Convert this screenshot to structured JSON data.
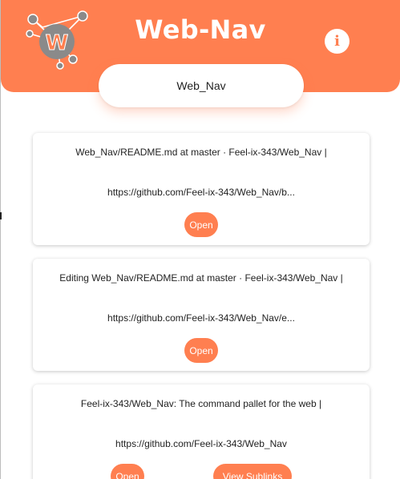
{
  "app": {
    "title": "Web-Nav",
    "info_icon": "info-icon",
    "logo_letter": "W"
  },
  "search": {
    "value": "Web_Nav"
  },
  "results": [
    {
      "title": "Web_Nav/README.md at master · Feel-ix-343/Web_Nav |",
      "url": "https://github.com/Feel-ix-343/Web_Nav/b...",
      "open_label": "Open"
    },
    {
      "title": "Editing Web_Nav/README.md at master · Feel-ix-343/Web_Nav |",
      "url": "https://github.com/Feel-ix-343/Web_Nav/e...",
      "open_label": "Open"
    },
    {
      "title": "Feel-ix-343/Web_Nav: The command pallet for the web |",
      "url": "https://github.com/Feel-ix-343/Web_Nav",
      "open_label": "Open",
      "sublinks_label": "View Sublinks"
    }
  ],
  "colors": {
    "accent": "#ff7f50",
    "logo_gray": "#8a8a8a",
    "background": "#ffffff"
  }
}
